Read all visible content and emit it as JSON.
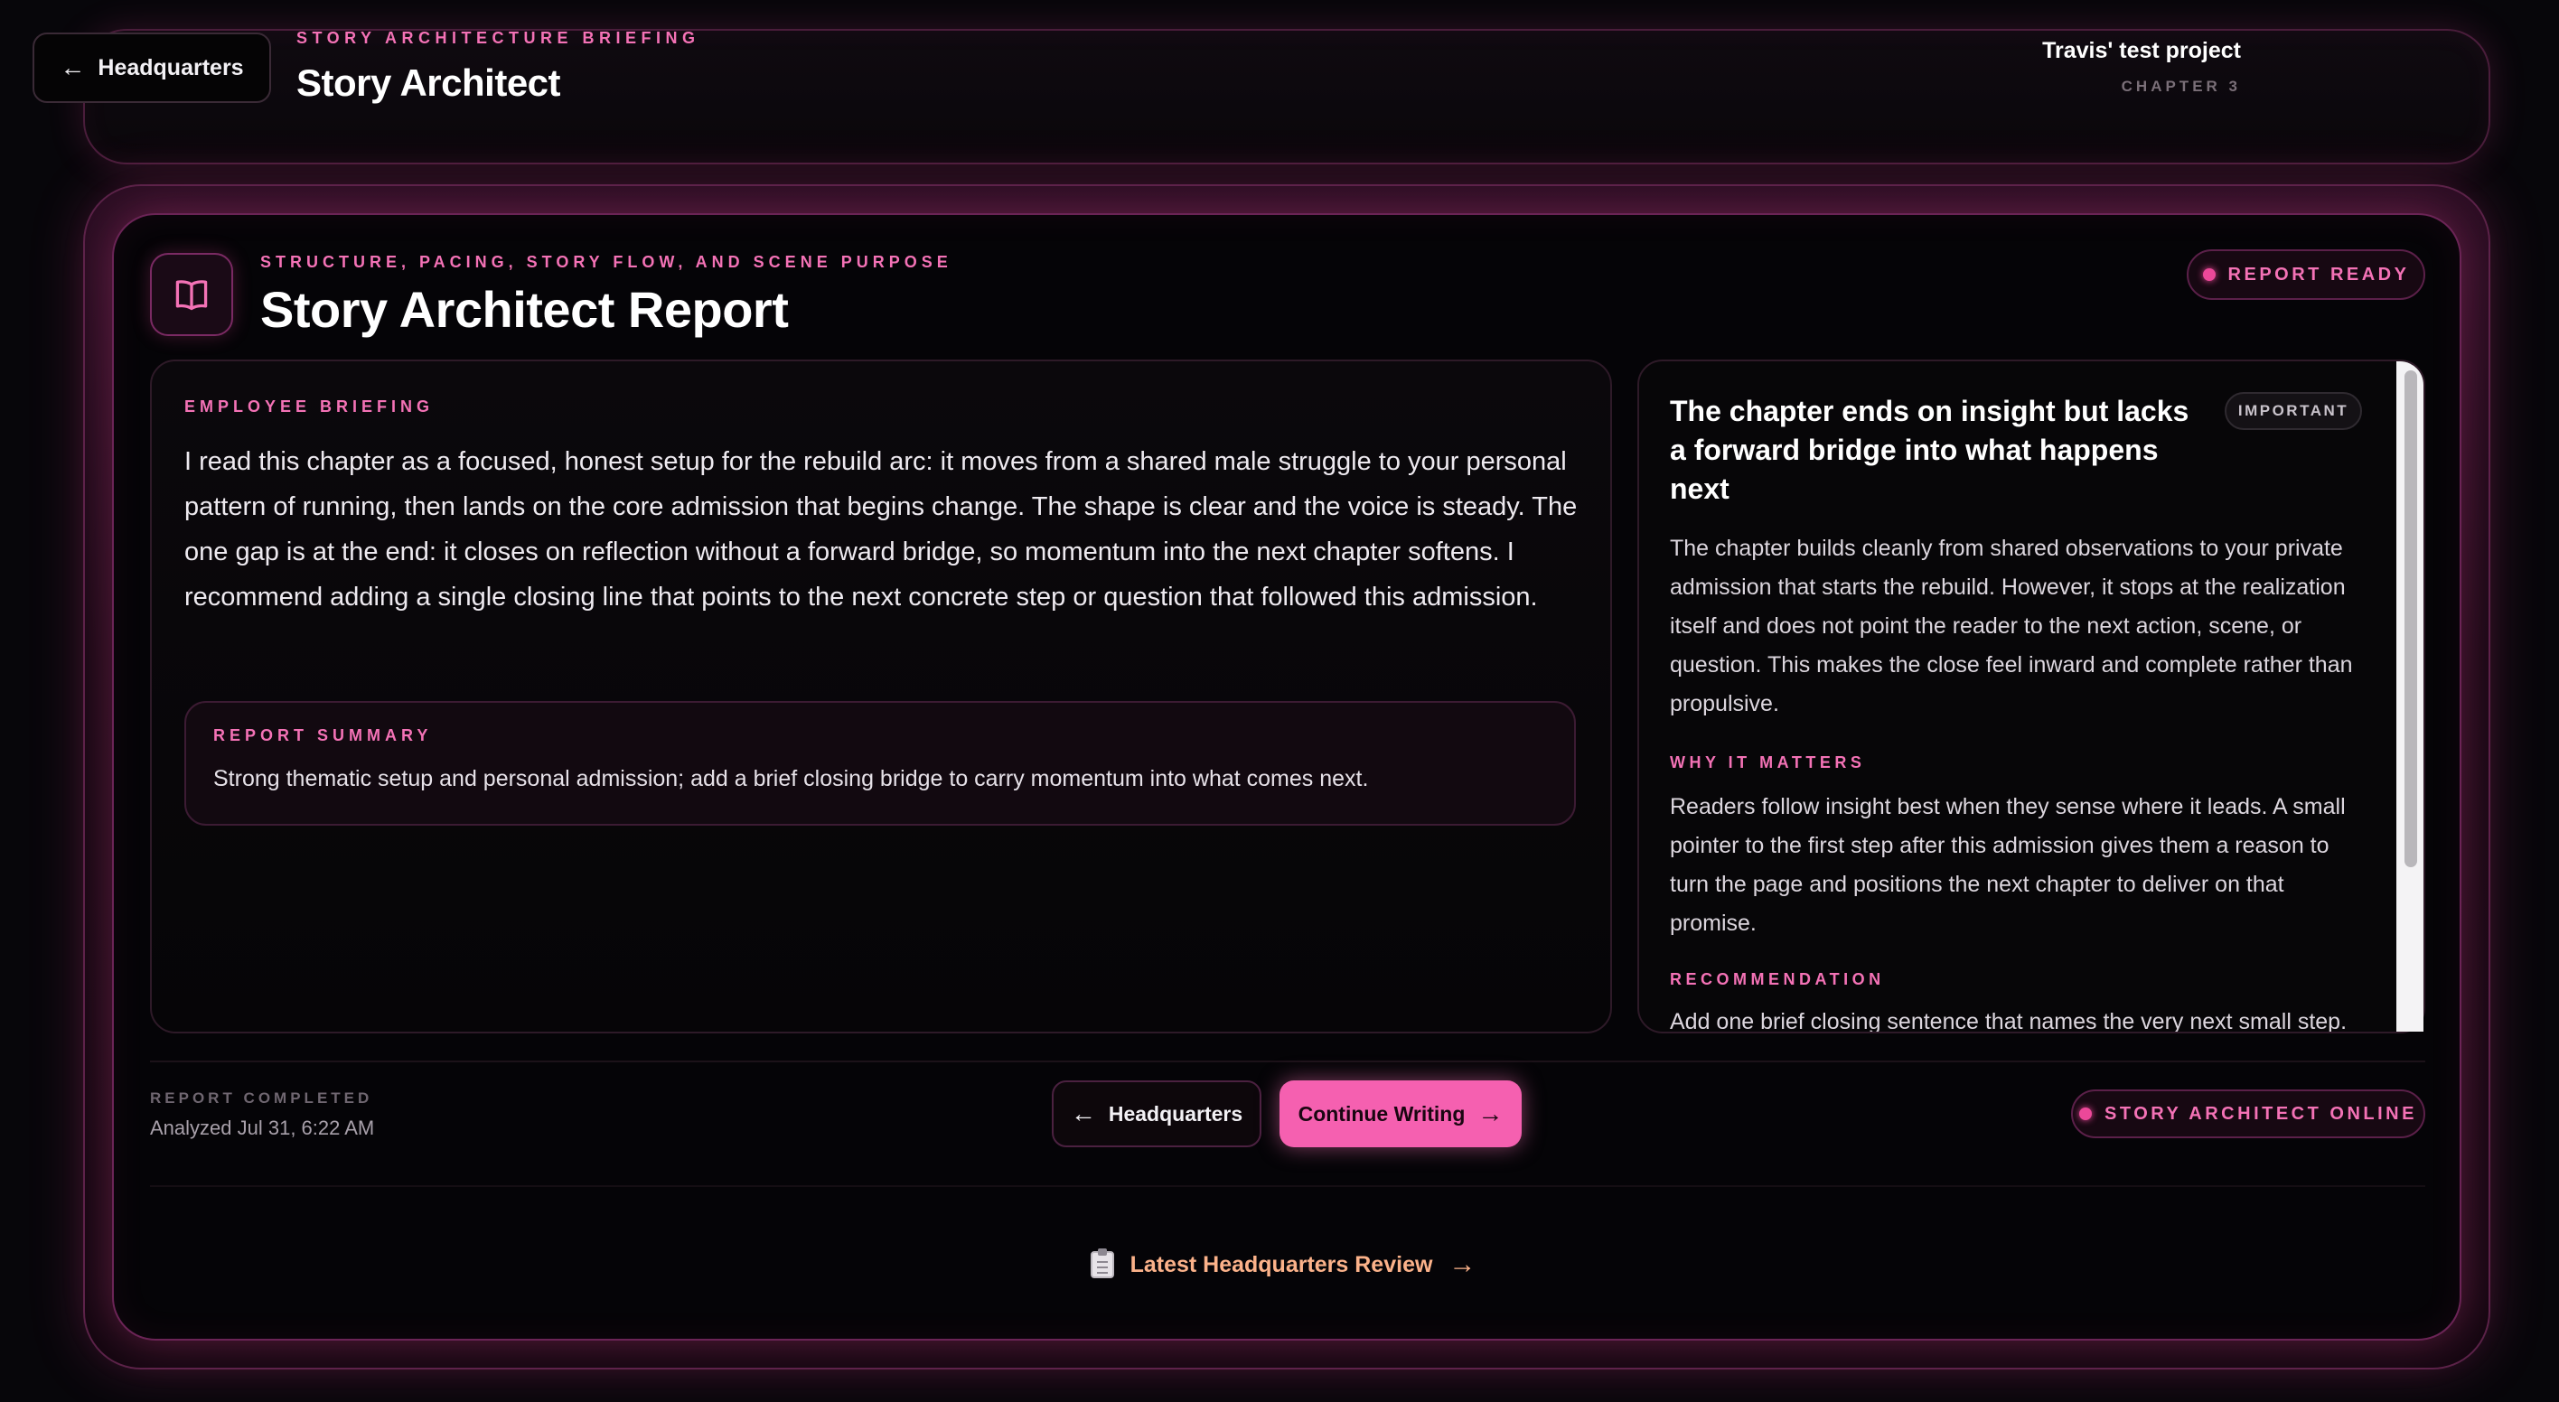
{
  "header": {
    "back_label": "Headquarters",
    "back_arrow": "←",
    "eyebrow": "STORY ARCHITECTURE BRIEFING",
    "title": "Story Architect",
    "project_name": "Travis' test project",
    "chapter": "CHAPTER 3"
  },
  "report": {
    "icon": "book-icon",
    "eyebrow": "STRUCTURE, PACING, STORY FLOW, AND SCENE PURPOSE",
    "title": "Story Architect Report",
    "status": "REPORT READY"
  },
  "briefing": {
    "eyebrow": "EMPLOYEE BRIEFING",
    "text": "I read this chapter as a focused, honest setup for the rebuild arc: it moves from a shared male struggle to your personal pattern of running, then lands on the core admission that begins change. The shape is clear and the voice is steady. The one gap is at the end: it closes on reflection without a forward bridge, so momentum into the next chapter softens. I recommend adding a single closing line that points to the next concrete step or question that followed this admission.",
    "summary_eyebrow": "REPORT SUMMARY",
    "summary_text": "Strong thematic setup and personal admission; add a brief closing bridge to carry momentum into what comes next."
  },
  "issue": {
    "title": "The chapter ends on insight but lacks a forward bridge into what happens next",
    "severity": "IMPORTANT",
    "body": "The chapter builds cleanly from shared observations to your private admission that starts the rebuild. However, it stops at the realization itself and does not point the reader to the next action, scene, or question. This makes the close feel inward and complete rather than propulsive.",
    "why_eyebrow": "WHY IT MATTERS",
    "why_body": "Readers follow insight best when they sense where it leads. A small pointer to the first step after this admission gives them a reason to turn the page and positions the next chapter to deliver on that promise.",
    "rec_eyebrow": "RECOMMENDATION",
    "rec_body": "Add one brief closing sentence that names the very next small step."
  },
  "footer": {
    "completed_eyebrow": "REPORT COMPLETED",
    "completed_time": "Analyzed Jul 31, 6:22 AM",
    "hq_label": "Headquarters",
    "hq_arrow": "←",
    "continue_label": "Continue Writing",
    "continue_arrow": "→",
    "online_status": "STORY ARCHITECT ONLINE",
    "latest_link": "Latest Headquarters Review",
    "latest_icon": "clipboard-icon",
    "latest_arrow": "→"
  },
  "colors": {
    "accent": "#f472b6",
    "button_pink": "#f560b0",
    "link_peach": "#fbb28a",
    "background": "#07060a"
  }
}
